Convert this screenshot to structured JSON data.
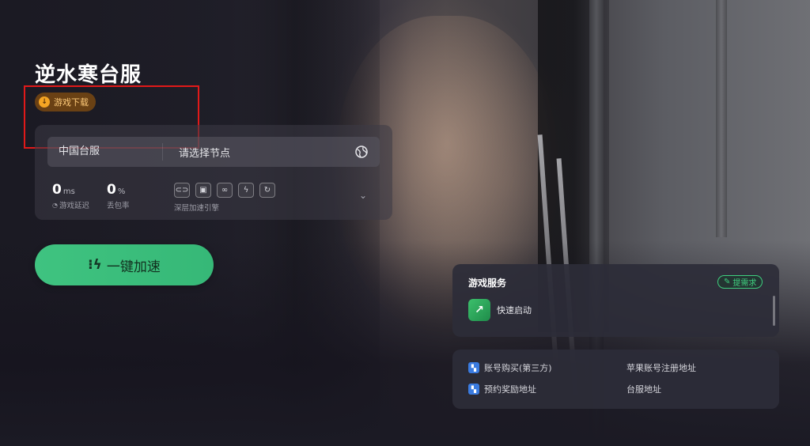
{
  "game": {
    "title": "逆水寒台服",
    "download_label": "游戏下载"
  },
  "server": {
    "region": "中国台服",
    "node_placeholder": "请选择节点"
  },
  "stats": {
    "latency_value": "0",
    "latency_unit": "ms",
    "latency_label": "游戏延迟",
    "loss_value": "0",
    "loss_unit": "%",
    "loss_label": "丢包率"
  },
  "engine": {
    "label": "深层加速引擎",
    "icons": [
      "link-icon",
      "screen-icon",
      "chain-icon",
      "bolt-icon",
      "refresh-icon"
    ]
  },
  "boost": {
    "label": "一键加速"
  },
  "service": {
    "title": "游戏服务",
    "request_label": "提需求",
    "quick_launch_label": "快速启动"
  },
  "links": {
    "items": [
      {
        "label": "账号购买(第三方)",
        "has_icon": true
      },
      {
        "label": "苹果账号注册地址",
        "has_icon": false
      },
      {
        "label": "预约奖励地址",
        "has_icon": true
      },
      {
        "label": "台服地址",
        "has_icon": false
      }
    ]
  },
  "colors": {
    "accent_green": "#3fc380",
    "highlight_red": "#e11919",
    "download_chip": "#7a4812"
  }
}
